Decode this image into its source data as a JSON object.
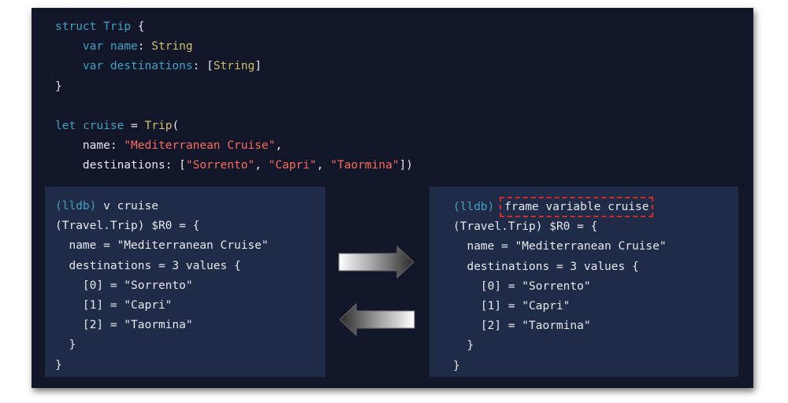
{
  "code": {
    "line1": {
      "kw": "struct",
      "name": "Trip",
      "brace": "{"
    },
    "line2": {
      "kw": "var",
      "name": "name",
      "type": "String"
    },
    "line3": {
      "kw": "var",
      "name": "destinations",
      "type": "String"
    },
    "line4": "}",
    "line6": {
      "kw": "let",
      "name": "cruise",
      "call": "Trip"
    },
    "line7": {
      "label": "name",
      "value": "\"Mediterranean Cruise\""
    },
    "line8": {
      "label": "destinations",
      "v0": "\"Sorrento\"",
      "v1": "\"Capri\"",
      "v2": "\"Taormina\""
    }
  },
  "lldb_left": {
    "prompt": "(lldb)",
    "command": "v cruise",
    "lines": [
      "(Travel.Trip) $R0 = {",
      "  name = \"Mediterranean Cruise\"",
      "  destinations = 3 values {",
      "    [0] = \"Sorrento\"",
      "    [1] = \"Capri\"",
      "    [2] = \"Taormina\"",
      "  }",
      "}"
    ]
  },
  "lldb_right": {
    "prompt": "(lldb)",
    "command": "frame variable cruise",
    "lines": [
      "(Travel.Trip) $R0 = {",
      "  name = \"Mediterranean Cruise\"",
      "  destinations = 3 values {",
      "    [0] = \"Sorrento\"",
      "    [1] = \"Capri\"",
      "    [2] = \"Taormina\"",
      "  }",
      "}"
    ]
  },
  "colors": {
    "background": "#111729",
    "lldb_box": "#1f2b47",
    "keyword": "#41a1c0",
    "type": "#d0bf69",
    "string": "#fc6a5d",
    "text": "#e6e8ee",
    "highlight_border": "#d12a2a"
  },
  "icons": {
    "right_arrow": "right-arrow-icon",
    "left_arrow": "left-arrow-icon"
  }
}
